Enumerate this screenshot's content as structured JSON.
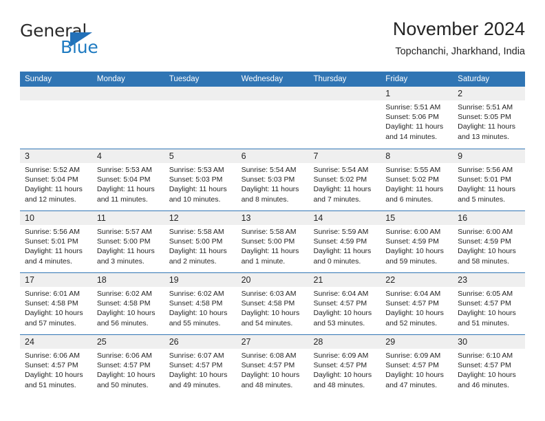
{
  "brand": {
    "name_part1": "General",
    "name_part2": "Blue",
    "triangle_color": "#2270b8",
    "blue_text_color": "#1f7bc1"
  },
  "header": {
    "month_title": "November 2024",
    "location": "Topchanchi, Jharkhand, India"
  },
  "theme": {
    "header_band": "#3075b4",
    "date_band": "#efefef",
    "text": "#232323"
  },
  "calendar": {
    "weekdays": [
      "Sunday",
      "Monday",
      "Tuesday",
      "Wednesday",
      "Thursday",
      "Friday",
      "Saturday"
    ],
    "weeks": [
      [
        {
          "day": "",
          "empty": true
        },
        {
          "day": "",
          "empty": true
        },
        {
          "day": "",
          "empty": true
        },
        {
          "day": "",
          "empty": true
        },
        {
          "day": "",
          "empty": true
        },
        {
          "day": "1",
          "sunrise": "Sunrise: 5:51 AM",
          "sunset": "Sunset: 5:06 PM",
          "daylight": "Daylight: 11 hours and 14 minutes."
        },
        {
          "day": "2",
          "sunrise": "Sunrise: 5:51 AM",
          "sunset": "Sunset: 5:05 PM",
          "daylight": "Daylight: 11 hours and 13 minutes."
        }
      ],
      [
        {
          "day": "3",
          "sunrise": "Sunrise: 5:52 AM",
          "sunset": "Sunset: 5:04 PM",
          "daylight": "Daylight: 11 hours and 12 minutes."
        },
        {
          "day": "4",
          "sunrise": "Sunrise: 5:53 AM",
          "sunset": "Sunset: 5:04 PM",
          "daylight": "Daylight: 11 hours and 11 minutes."
        },
        {
          "day": "5",
          "sunrise": "Sunrise: 5:53 AM",
          "sunset": "Sunset: 5:03 PM",
          "daylight": "Daylight: 11 hours and 10 minutes."
        },
        {
          "day": "6",
          "sunrise": "Sunrise: 5:54 AM",
          "sunset": "Sunset: 5:03 PM",
          "daylight": "Daylight: 11 hours and 8 minutes."
        },
        {
          "day": "7",
          "sunrise": "Sunrise: 5:54 AM",
          "sunset": "Sunset: 5:02 PM",
          "daylight": "Daylight: 11 hours and 7 minutes."
        },
        {
          "day": "8",
          "sunrise": "Sunrise: 5:55 AM",
          "sunset": "Sunset: 5:02 PM",
          "daylight": "Daylight: 11 hours and 6 minutes."
        },
        {
          "day": "9",
          "sunrise": "Sunrise: 5:56 AM",
          "sunset": "Sunset: 5:01 PM",
          "daylight": "Daylight: 11 hours and 5 minutes."
        }
      ],
      [
        {
          "day": "10",
          "sunrise": "Sunrise: 5:56 AM",
          "sunset": "Sunset: 5:01 PM",
          "daylight": "Daylight: 11 hours and 4 minutes."
        },
        {
          "day": "11",
          "sunrise": "Sunrise: 5:57 AM",
          "sunset": "Sunset: 5:00 PM",
          "daylight": "Daylight: 11 hours and 3 minutes."
        },
        {
          "day": "12",
          "sunrise": "Sunrise: 5:58 AM",
          "sunset": "Sunset: 5:00 PM",
          "daylight": "Daylight: 11 hours and 2 minutes."
        },
        {
          "day": "13",
          "sunrise": "Sunrise: 5:58 AM",
          "sunset": "Sunset: 5:00 PM",
          "daylight": "Daylight: 11 hours and 1 minute."
        },
        {
          "day": "14",
          "sunrise": "Sunrise: 5:59 AM",
          "sunset": "Sunset: 4:59 PM",
          "daylight": "Daylight: 11 hours and 0 minutes."
        },
        {
          "day": "15",
          "sunrise": "Sunrise: 6:00 AM",
          "sunset": "Sunset: 4:59 PM",
          "daylight": "Daylight: 10 hours and 59 minutes."
        },
        {
          "day": "16",
          "sunrise": "Sunrise: 6:00 AM",
          "sunset": "Sunset: 4:59 PM",
          "daylight": "Daylight: 10 hours and 58 minutes."
        }
      ],
      [
        {
          "day": "17",
          "sunrise": "Sunrise: 6:01 AM",
          "sunset": "Sunset: 4:58 PM",
          "daylight": "Daylight: 10 hours and 57 minutes."
        },
        {
          "day": "18",
          "sunrise": "Sunrise: 6:02 AM",
          "sunset": "Sunset: 4:58 PM",
          "daylight": "Daylight: 10 hours and 56 minutes."
        },
        {
          "day": "19",
          "sunrise": "Sunrise: 6:02 AM",
          "sunset": "Sunset: 4:58 PM",
          "daylight": "Daylight: 10 hours and 55 minutes."
        },
        {
          "day": "20",
          "sunrise": "Sunrise: 6:03 AM",
          "sunset": "Sunset: 4:58 PM",
          "daylight": "Daylight: 10 hours and 54 minutes."
        },
        {
          "day": "21",
          "sunrise": "Sunrise: 6:04 AM",
          "sunset": "Sunset: 4:57 PM",
          "daylight": "Daylight: 10 hours and 53 minutes."
        },
        {
          "day": "22",
          "sunrise": "Sunrise: 6:04 AM",
          "sunset": "Sunset: 4:57 PM",
          "daylight": "Daylight: 10 hours and 52 minutes."
        },
        {
          "day": "23",
          "sunrise": "Sunrise: 6:05 AM",
          "sunset": "Sunset: 4:57 PM",
          "daylight": "Daylight: 10 hours and 51 minutes."
        }
      ],
      [
        {
          "day": "24",
          "sunrise": "Sunrise: 6:06 AM",
          "sunset": "Sunset: 4:57 PM",
          "daylight": "Daylight: 10 hours and 51 minutes."
        },
        {
          "day": "25",
          "sunrise": "Sunrise: 6:06 AM",
          "sunset": "Sunset: 4:57 PM",
          "daylight": "Daylight: 10 hours and 50 minutes."
        },
        {
          "day": "26",
          "sunrise": "Sunrise: 6:07 AM",
          "sunset": "Sunset: 4:57 PM",
          "daylight": "Daylight: 10 hours and 49 minutes."
        },
        {
          "day": "27",
          "sunrise": "Sunrise: 6:08 AM",
          "sunset": "Sunset: 4:57 PM",
          "daylight": "Daylight: 10 hours and 48 minutes."
        },
        {
          "day": "28",
          "sunrise": "Sunrise: 6:09 AM",
          "sunset": "Sunset: 4:57 PM",
          "daylight": "Daylight: 10 hours and 48 minutes."
        },
        {
          "day": "29",
          "sunrise": "Sunrise: 6:09 AM",
          "sunset": "Sunset: 4:57 PM",
          "daylight": "Daylight: 10 hours and 47 minutes."
        },
        {
          "day": "30",
          "sunrise": "Sunrise: 6:10 AM",
          "sunset": "Sunset: 4:57 PM",
          "daylight": "Daylight: 10 hours and 46 minutes."
        }
      ]
    ]
  }
}
